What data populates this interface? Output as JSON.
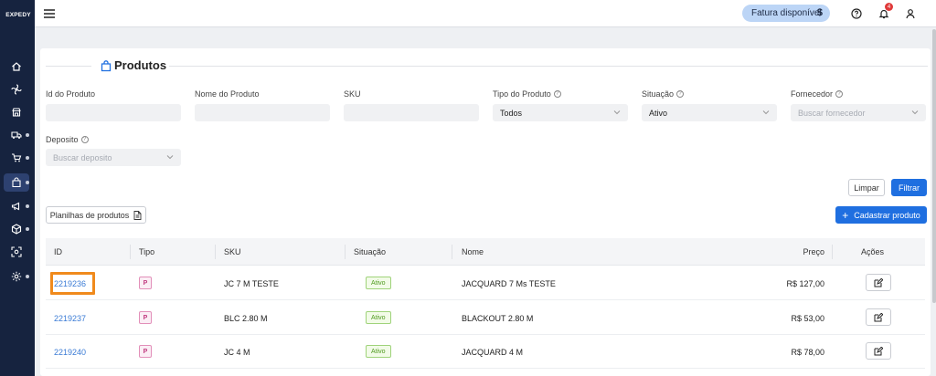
{
  "app": {
    "brand": "EXPEDY"
  },
  "header": {
    "fatura_label": "Fatura disponível",
    "fatura_symbol": "$",
    "notifications_count": "4"
  },
  "page": {
    "title": "Produtos"
  },
  "filters": {
    "id_label": "Id do Produto",
    "nome_label": "Nome do Produto",
    "sku_label": "SKU",
    "tipo_label": "Tipo do Produto",
    "tipo_value": "Todos",
    "situacao_label": "Situação",
    "situacao_value": "Ativo",
    "fornecedor_label": "Fornecedor",
    "fornecedor_placeholder": "Buscar fornecedor",
    "deposito_label": "Deposito",
    "deposito_placeholder": "Buscar deposito",
    "help": "?"
  },
  "actions": {
    "limpar": "Limpar",
    "filtrar": "Filtrar",
    "planilhas": "Planilhas de produtos",
    "cadastrar": "Cadastrar produto",
    "plus": "+"
  },
  "table": {
    "headers": {
      "id": "ID",
      "tipo": "Tipo",
      "sku": "SKU",
      "situacao": "Situação",
      "nome": "Nome",
      "preco": "Preço",
      "acoes": "Ações"
    },
    "rows": [
      {
        "id": "2219236",
        "tipo": "P",
        "sku": "JC 7 M TESTE",
        "situacao": "Ativo",
        "nome": "JACQUARD 7 Ms TESTE",
        "preco": "R$ 127,00"
      },
      {
        "id": "2219237",
        "tipo": "P",
        "sku": "BLC 2.80 M",
        "situacao": "Ativo",
        "nome": "BLACKOUT 2.80 M",
        "preco": "R$ 53,00"
      },
      {
        "id": "2219240",
        "tipo": "P",
        "sku": "JC 4 M",
        "situacao": "Ativo",
        "nome": "JACQUARD 4 M",
        "preco": "R$ 78,00"
      }
    ]
  },
  "colors": {
    "sidebar": "#16233f",
    "primary": "#1f6fe0",
    "link": "#3a7bd5",
    "highlight": "#f08a1c",
    "status_green": "#4e9a1e"
  }
}
